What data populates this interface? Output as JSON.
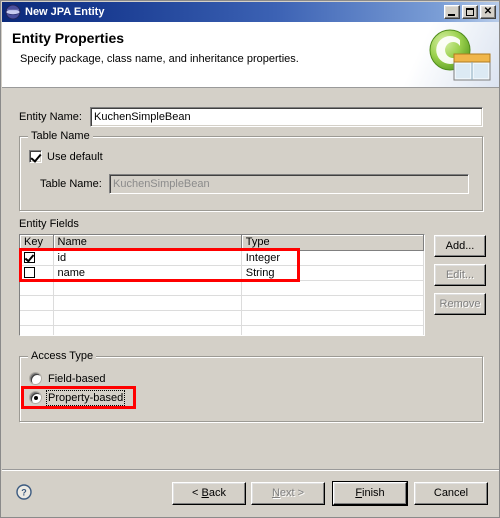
{
  "window": {
    "title": "New JPA Entity",
    "icon": "eclipse-globe-icon",
    "controls": {
      "minimize": "minimize-icon",
      "maximize": "maximize-icon",
      "close": "close-icon"
    }
  },
  "banner": {
    "title": "Entity Properties",
    "subtitle": "Specify package, class name, and inheritance properties.",
    "icon": "jpa-entity-wizard-icon"
  },
  "form": {
    "entity_name_label": "Entity Name:",
    "entity_name_value": "KuchenSimpleBean",
    "table_name_group": "Table Name",
    "use_default_label": "Use default",
    "use_default_checked": true,
    "table_name_label": "Table Name:",
    "table_name_value": "KuchenSimpleBean",
    "table_name_disabled": true
  },
  "entity_fields": {
    "label": "Entity Fields",
    "columns": [
      "Key",
      "Name",
      "Type"
    ],
    "rows": [
      {
        "key_checked": true,
        "name": "id",
        "type": "Integer"
      },
      {
        "key_checked": false,
        "name": "name",
        "type": "String"
      }
    ],
    "empty_row_count": 4,
    "buttons": [
      {
        "label": "Add...",
        "enabled": true
      },
      {
        "label": "Edit...",
        "enabled": false
      },
      {
        "label": "Remove",
        "enabled": false
      }
    ]
  },
  "access_type": {
    "group_label": "Access Type",
    "options": [
      {
        "label": "Field-based",
        "selected": false
      },
      {
        "label": "Property-based",
        "selected": true
      }
    ]
  },
  "footer": {
    "help_icon": "help-question-icon",
    "back_label": "< Back",
    "next_label": "Next >",
    "finish_label": "Finish",
    "cancel_label": "Cancel",
    "next_enabled": false,
    "finish_default": true
  },
  "colors": {
    "dialog_bg": "#d4d0c8",
    "titlebar_start": "#0b2a7a",
    "titlebar_end": "#b9cdea",
    "annotation": "#ff0000",
    "field_bg": "#ffffff",
    "disabled_text": "#808080"
  }
}
